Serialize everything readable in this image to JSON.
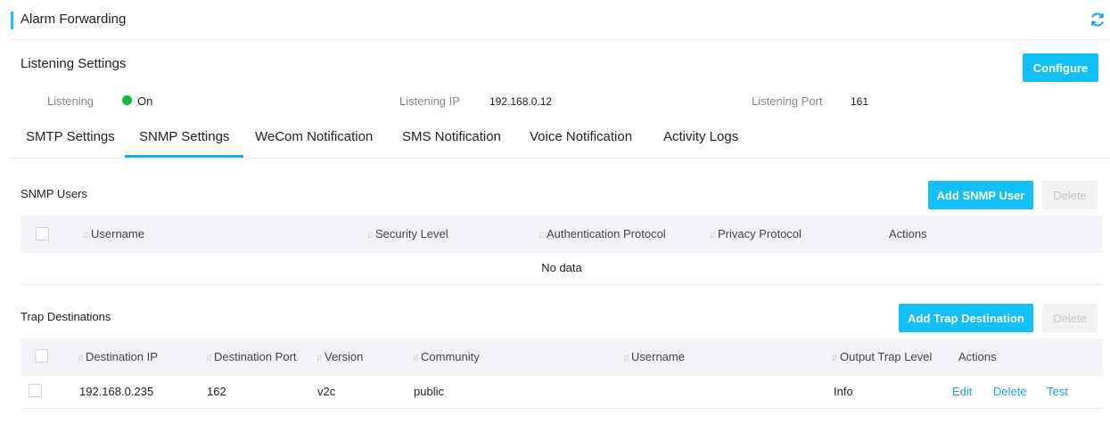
{
  "header": {
    "title": "Alarm Forwarding",
    "refresh_icon": "refresh-icon"
  },
  "listening": {
    "title": "Listening Settings",
    "configure_label": "Configure",
    "fields": [
      {
        "label": "Listening",
        "value": "On",
        "status_color": "#18b64a"
      },
      {
        "label": "Listening IP",
        "value": "192.168.0.12"
      },
      {
        "label": "Listening Port",
        "value": "161"
      }
    ]
  },
  "tabs": [
    {
      "label": "SMTP Settings"
    },
    {
      "label": "SNMP Settings",
      "active": true
    },
    {
      "label": "WeCom Notification"
    },
    {
      "label": "SMS Notification"
    },
    {
      "label": "Voice Notification"
    },
    {
      "label": "Activity Logs"
    }
  ],
  "snmp_users": {
    "title": "SNMP Users",
    "add_label": "Add SNMP User",
    "delete_label": "Delete",
    "columns": [
      "Username",
      "Security Level",
      "Authentication Protocol",
      "Privacy Protocol",
      "Actions"
    ],
    "empty_text": "No data"
  },
  "trap_destinations": {
    "title": "Trap Destinations",
    "add_label": "Add Trap Destination",
    "delete_label": "Delete",
    "columns": [
      "Destination IP",
      "Destination Port",
      "Version",
      "Community",
      "Username",
      "Output Trap Level",
      "Actions"
    ],
    "rows": [
      {
        "destination_ip": "192.168.0.235",
        "destination_port": "162",
        "version": "v2c",
        "community": "public",
        "username": "",
        "output_trap_level": "Info",
        "actions": [
          "Edit",
          "Delete",
          "Test"
        ]
      }
    ]
  },
  "colors": {
    "accent": "#12c0f5",
    "link": "#1aa3e8",
    "status_on": "#18b64a"
  }
}
